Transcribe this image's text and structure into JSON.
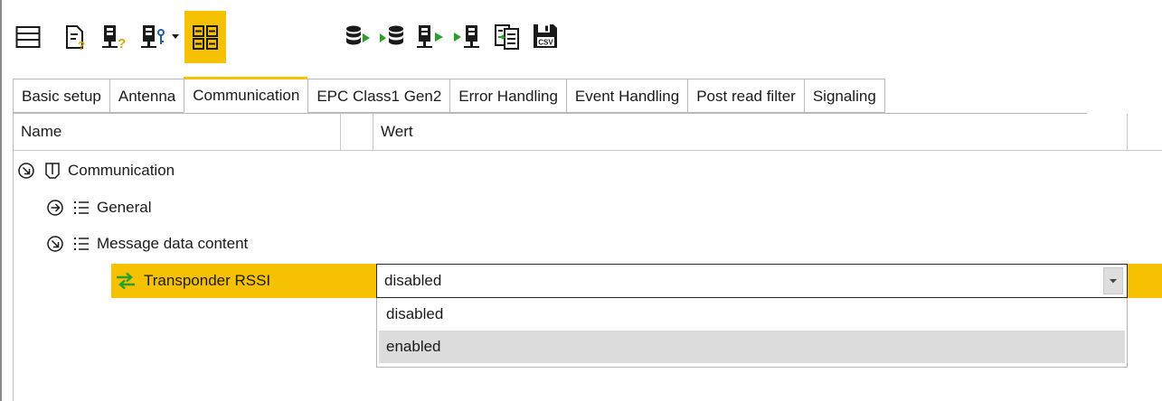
{
  "toolbar": {
    "buttons": [
      {
        "icon": "panel-layout-icon"
      },
      {
        "icon": "document-question-icon"
      },
      {
        "icon": "device-question-icon"
      },
      {
        "icon": "device-key-icon"
      },
      {
        "icon": "grid-view-icon",
        "active": true
      },
      {
        "icon": "database-read-icon"
      },
      {
        "icon": "database-write-icon"
      },
      {
        "icon": "device-read-icon"
      },
      {
        "icon": "device-write-icon"
      },
      {
        "icon": "compare-table-icon"
      },
      {
        "icon": "save-csv-icon",
        "badge": "CSV"
      }
    ]
  },
  "tabs": [
    {
      "label": "Basic setup"
    },
    {
      "label": "Antenna"
    },
    {
      "label": "Communication",
      "selected": true
    },
    {
      "label": "EPC Class1 Gen2"
    },
    {
      "label": "Error Handling"
    },
    {
      "label": "Event Handling"
    },
    {
      "label": "Post read filter"
    },
    {
      "label": "Signaling"
    }
  ],
  "grid": {
    "header_name": "Name",
    "header_value": "Wert",
    "tree": {
      "root": "Communication",
      "general": "General",
      "message": "Message data content",
      "setting": "Transponder RSSI"
    },
    "combo": {
      "value": "disabled",
      "options": [
        "disabled",
        "enabled"
      ],
      "highlighted": "enabled"
    }
  },
  "colors": {
    "accent": "#f6c100",
    "green": "#2aa02a",
    "dark": "#1a1a1a"
  }
}
